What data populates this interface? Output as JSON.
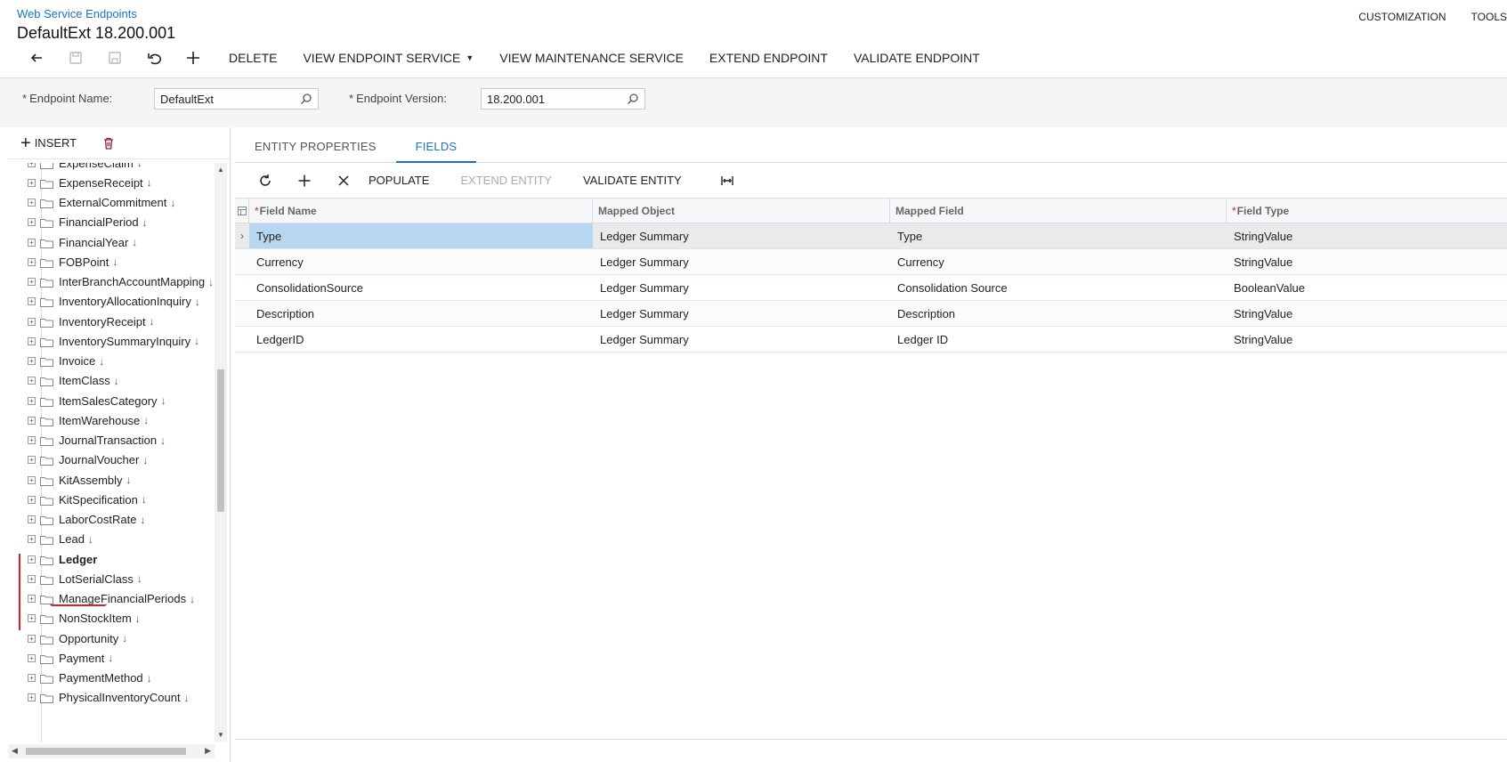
{
  "header": {
    "breadcrumb": "Web Service Endpoints",
    "title": "DefaultExt 18.200.001",
    "customization": "CUSTOMIZATION",
    "tools": "TOOLS"
  },
  "toolbar": {
    "delete": "DELETE",
    "view_endpoint_service": "VIEW ENDPOINT SERVICE",
    "view_maintenance_service": "VIEW MAINTENANCE SERVICE",
    "extend_endpoint": "EXTEND ENDPOINT",
    "validate_endpoint": "VALIDATE ENDPOINT"
  },
  "form": {
    "endpoint_name_label": "Endpoint Name:",
    "endpoint_name_value": "DefaultExt",
    "endpoint_version_label": "Endpoint Version:",
    "endpoint_version_value": "18.200.001",
    "required_mark": "*"
  },
  "left_panel": {
    "insert": "INSERT",
    "tree": [
      {
        "label": "ExpenseClaim",
        "selected": false
      },
      {
        "label": "ExpenseReceipt",
        "selected": false
      },
      {
        "label": "ExternalCommitment",
        "selected": false
      },
      {
        "label": "FinancialPeriod",
        "selected": false
      },
      {
        "label": "FinancialYear",
        "selected": false
      },
      {
        "label": "FOBPoint",
        "selected": false
      },
      {
        "label": "InterBranchAccountMapping",
        "selected": false
      },
      {
        "label": "InventoryAllocationInquiry",
        "selected": false
      },
      {
        "label": "InventoryReceipt",
        "selected": false
      },
      {
        "label": "InventorySummaryInquiry",
        "selected": false
      },
      {
        "label": "Invoice",
        "selected": false
      },
      {
        "label": "ItemClass",
        "selected": false
      },
      {
        "label": "ItemSalesCategory",
        "selected": false
      },
      {
        "label": "ItemWarehouse",
        "selected": false
      },
      {
        "label": "JournalTransaction",
        "selected": false
      },
      {
        "label": "JournalVoucher",
        "selected": false
      },
      {
        "label": "KitAssembly",
        "selected": false
      },
      {
        "label": "KitSpecification",
        "selected": false
      },
      {
        "label": "LaborCostRate",
        "selected": false
      },
      {
        "label": "Lead",
        "selected": false
      },
      {
        "label": "Ledger",
        "selected": true
      },
      {
        "label": "LotSerialClass",
        "selected": false
      },
      {
        "label": "ManageFinancialPeriods",
        "selected": false
      },
      {
        "label": "NonStockItem",
        "selected": false
      },
      {
        "label": "Opportunity",
        "selected": false
      },
      {
        "label": "Payment",
        "selected": false
      },
      {
        "label": "PaymentMethod",
        "selected": false
      },
      {
        "label": "PhysicalInventoryCount",
        "selected": false
      }
    ]
  },
  "tabs": [
    "ENTITY PROPERTIES",
    "FIELDS"
  ],
  "active_tab": "FIELDS",
  "grid_toolbar": {
    "populate": "POPULATE",
    "extend_entity": "EXTEND ENTITY",
    "validate_entity": "VALIDATE ENTITY"
  },
  "grid": {
    "columns": [
      "Field Name",
      "Mapped Object",
      "Mapped Field",
      "Field Type"
    ],
    "rows": [
      [
        "Type",
        "Ledger Summary",
        "Type",
        "StringValue"
      ],
      [
        "Currency",
        "Ledger Summary",
        "Currency",
        "StringValue"
      ],
      [
        "ConsolidationSource",
        "Ledger Summary",
        "Consolidation Source",
        "BooleanValue"
      ],
      [
        "Description",
        "Ledger Summary",
        "Description",
        "StringValue"
      ],
      [
        "LedgerID",
        "Ledger Summary",
        "Ledger ID",
        "StringValue"
      ]
    ]
  },
  "colors": {
    "accent": "#1a73c8",
    "selected_cell": "#b8d6f0",
    "annotation": "#e02020"
  }
}
